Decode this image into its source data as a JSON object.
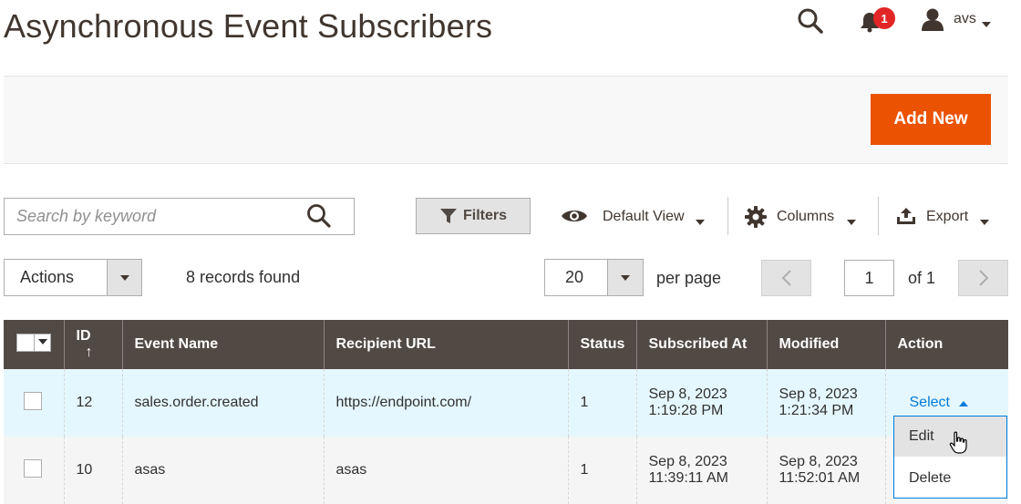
{
  "header": {
    "title": "Asynchronous Event Subscribers",
    "notification_count": "1",
    "user_name": "avs"
  },
  "action_bar": {
    "add_new_label": "Add New"
  },
  "toolbar": {
    "search_placeholder": "Search by keyword",
    "filters_label": "Filters",
    "view_label": "Default View",
    "columns_label": "Columns",
    "export_label": "Export"
  },
  "paging": {
    "actions_label": "Actions",
    "records_found": "8 records found",
    "page_size": "20",
    "per_page_label": "per page",
    "current_page": "1",
    "of_total": "of 1"
  },
  "table": {
    "columns": [
      "ID",
      "Event Name",
      "Recipient URL",
      "Status",
      "Subscribed At",
      "Modified",
      "Action"
    ],
    "sort_indicator": "↑",
    "rows": [
      {
        "id": "12",
        "event_name": "sales.order.created",
        "recipient_url": "https://endpoint.com/",
        "status": "1",
        "subscribed_date": "Sep 8, 2023",
        "subscribed_time": "1:19:28 PM",
        "modified_date": "Sep 8, 2023",
        "modified_time": "1:21:34 PM",
        "action": "Select"
      },
      {
        "id": "10",
        "event_name": "asas",
        "recipient_url": "asas",
        "status": "1",
        "subscribed_date": "Sep 8, 2023",
        "subscribed_time": "11:39:11 AM",
        "modified_date": "Sep 8, 2023",
        "modified_time": "11:52:01 AM",
        "action": ""
      }
    ]
  },
  "action_menu": {
    "items": [
      "Edit",
      "Delete"
    ]
  },
  "colors": {
    "accent": "#eb5202",
    "header_bg": "#514943",
    "link": "#007bdb",
    "badge": "#e22626"
  },
  "icons": [
    "search-icon",
    "bell-icon",
    "user-icon",
    "filter-icon",
    "eye-icon",
    "gear-icon",
    "export-icon",
    "chevron-left-icon",
    "chevron-right-icon",
    "cursor-hand-icon"
  ]
}
